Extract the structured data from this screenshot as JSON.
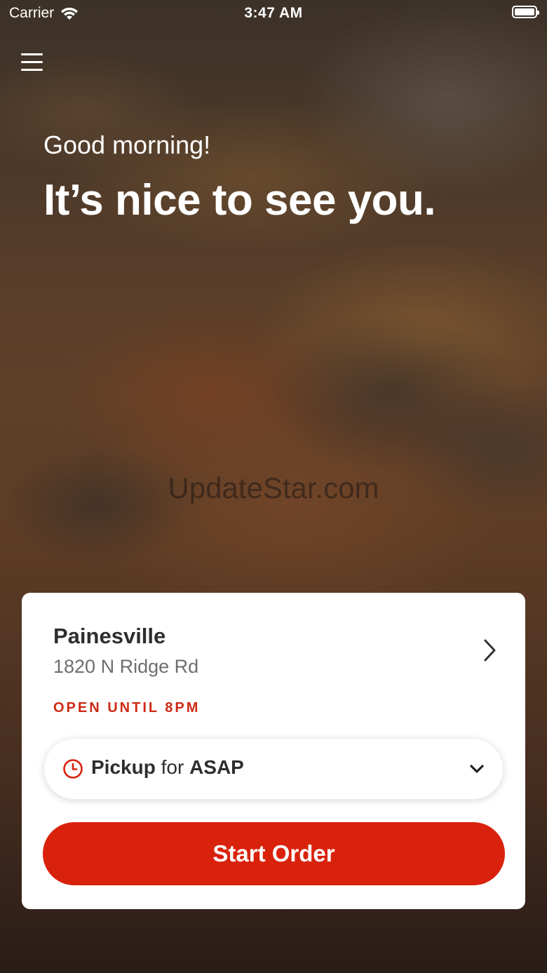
{
  "status_bar": {
    "carrier": "Carrier",
    "time": "3:47 AM"
  },
  "hero": {
    "greeting": "Good morning!",
    "headline": "It’s nice to see you."
  },
  "watermark": "UpdateStar.com",
  "location_card": {
    "store_name": "Painesville",
    "address": "1820 N Ridge Rd",
    "hours_status": "OPEN UNTIL 8PM",
    "order_mode": {
      "method": "Pickup",
      "connector": "for",
      "time": "ASAP"
    },
    "start_button_label": "Start Order"
  },
  "colors": {
    "accent": "#d9220c",
    "status_red": "#cc2a14",
    "card_bg": "#ffffff"
  },
  "icons": [
    "menu-icon",
    "wifi-icon",
    "battery-icon",
    "chevron-right-icon",
    "clock-icon",
    "chevron-down-icon"
  ]
}
